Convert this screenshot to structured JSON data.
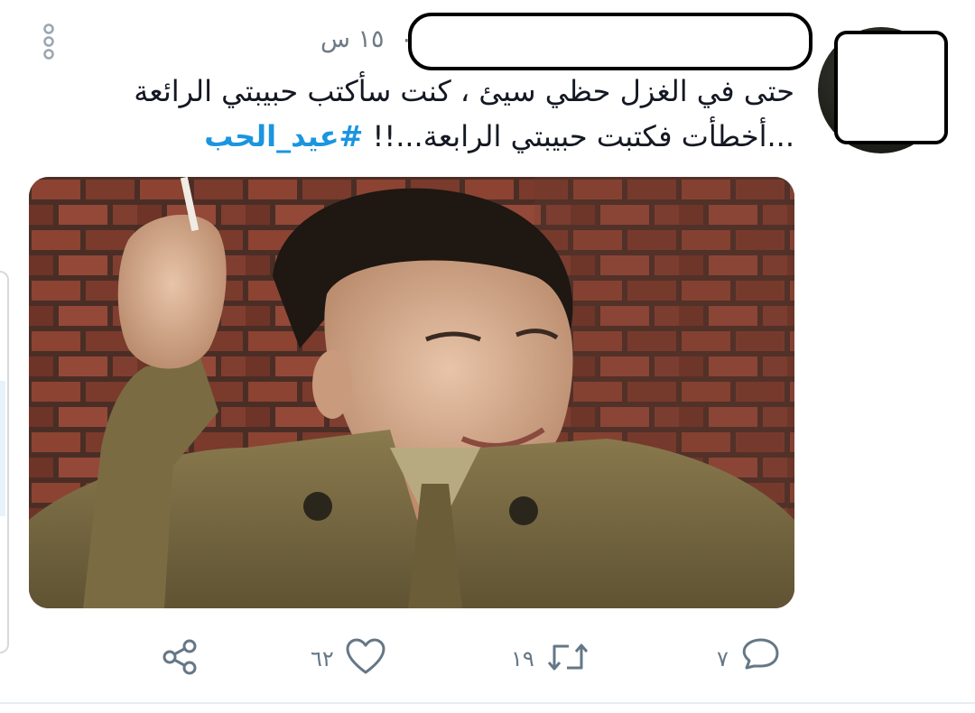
{
  "tweet": {
    "timestamp": "١٥ س",
    "separator": "·",
    "text_main": "حتى في الغزل حظي سيئ ، كنت سأكتب حبيبتي الرائعة ...أخطأت فكتبت حبيبتي الرابعة...!!",
    "hashtag": "#عيد_الحب",
    "media_alt": "man in olive military uniform holding a cigarette, smiling, brick wall background"
  },
  "actions": {
    "reply_count": "٧",
    "retweet_count": "١٩",
    "like_count": "٦٢"
  },
  "colors": {
    "text": "#141823",
    "muted": "#657786",
    "hashtag": "#1b95e0"
  },
  "icons": {
    "more": "more-vertical-icon",
    "reply": "reply-icon",
    "retweet": "retweet-icon",
    "like": "heart-icon",
    "share": "share-icon"
  }
}
